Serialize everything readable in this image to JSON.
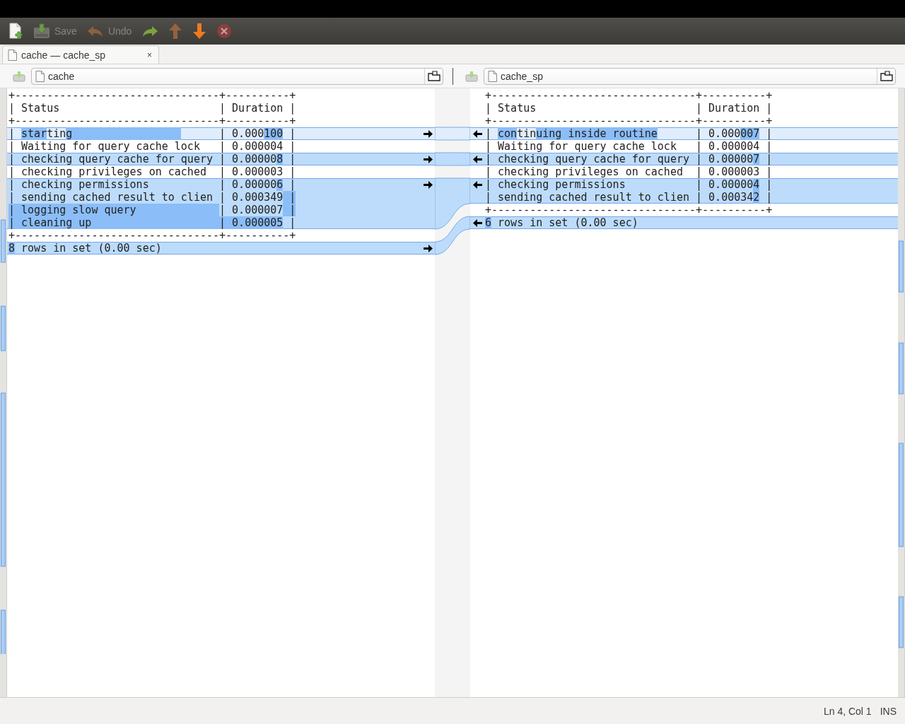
{
  "toolbar": [
    {
      "kind": "new",
      "disabled": false
    },
    {
      "kind": "save",
      "label": "Save",
      "disabled": true
    },
    {
      "kind": "undo",
      "label": "Undo",
      "disabled": true
    },
    {
      "kind": "redo",
      "disabled": false
    },
    {
      "kind": "up",
      "disabled": true
    },
    {
      "kind": "down",
      "disabled": false
    },
    {
      "kind": "stop",
      "disabled": true
    }
  ],
  "tabs": [
    {
      "label": "cache — cache_sp",
      "close": "×",
      "selected": true
    }
  ],
  "panes": [
    {
      "file": "cache",
      "lines": [
        {
          "kind": "plain",
          "arrow": false,
          "text": "+--------------------------------+----------+"
        },
        {
          "kind": "plain",
          "arrow": false,
          "text": "| Status                         | Duration |"
        },
        {
          "kind": "plain",
          "arrow": false,
          "text": "+--------------------------------+----------+"
        },
        {
          "kind": "current",
          "arrow": true,
          "segments": [
            {
              "text": "| ",
              "changed": false
            },
            {
              "text": "star",
              "changed": true
            },
            {
              "text": "tin",
              "changed": false
            },
            {
              "text": "g                 ",
              "changed": true
            },
            {
              "text": "      | 0.000",
              "changed": false
            },
            {
              "text": "100",
              "changed": true
            },
            {
              "text": " |",
              "changed": false
            }
          ]
        },
        {
          "kind": "plain",
          "arrow": false,
          "text": "| Waiting for query cache lock   | 0.000004 |"
        },
        {
          "kind": "changed",
          "arrow": true,
          "segments": [
            {
              "text": "| checking query cache for query | 0.00000",
              "changed": false
            },
            {
              "text": "8",
              "changed": true
            },
            {
              "text": " |",
              "changed": false
            }
          ]
        },
        {
          "kind": "plain",
          "arrow": false,
          "text": "| checking privileges on cached  | 0.000003 |"
        },
        {
          "kind": "changed",
          "arrow": true,
          "segments": [
            {
              "text": "| checking permissions           | 0.00000",
              "changed": false
            },
            {
              "text": "6",
              "changed": true
            },
            {
              "text": " |",
              "changed": false
            }
          ]
        },
        {
          "kind": "changed",
          "arrow": false,
          "segments": [
            {
              "text": "| sending cached result to clien | 0.000349",
              "changed": false
            },
            {
              "text": " |",
              "changed": true
            }
          ]
        },
        {
          "kind": "changed",
          "arrow": false,
          "segments": [
            {
              "text": "| logging slow query             ",
              "changed": true
            },
            {
              "text": "| 0.000007",
              "changed": false
            },
            {
              "text": " |",
              "changed": true
            }
          ]
        },
        {
          "kind": "changed",
          "arrow": false,
          "segments": [
            {
              "text": "| cleaning up                    | 0.000005",
              "changed": true
            },
            {
              "text": " |",
              "changed": false
            }
          ]
        },
        {
          "kind": "plain",
          "arrow": false,
          "text": "+--------------------------------+----------+"
        },
        {
          "kind": "changed",
          "arrow": true,
          "segments": [
            {
              "text": "8",
              "changed": true
            },
            {
              "text": " rows in set (0.00 sec)",
              "changed": false
            }
          ]
        }
      ]
    },
    {
      "file": "cache_sp",
      "lines": [
        {
          "kind": "plain",
          "arrow": false,
          "text": "+--------------------------------+----------+"
        },
        {
          "kind": "plain",
          "arrow": false,
          "text": "| Status                         | Duration |"
        },
        {
          "kind": "plain",
          "arrow": false,
          "text": "+--------------------------------+----------+"
        },
        {
          "kind": "current",
          "arrow": true,
          "segments": [
            {
              "text": "| ",
              "changed": false
            },
            {
              "text": "con",
              "changed": true
            },
            {
              "text": "tin",
              "changed": false
            },
            {
              "text": "uing inside routine",
              "changed": true
            },
            {
              "text": "      | 0.000",
              "changed": false
            },
            {
              "text": "007",
              "changed": true
            },
            {
              "text": " |",
              "changed": false
            }
          ]
        },
        {
          "kind": "plain",
          "arrow": false,
          "text": "| Waiting for query cache lock   | 0.000004 |"
        },
        {
          "kind": "changed",
          "arrow": true,
          "segments": [
            {
              "text": "| checking query cache for query | 0.00000",
              "changed": false
            },
            {
              "text": "7",
              "changed": true
            },
            {
              "text": " |",
              "changed": false
            }
          ]
        },
        {
          "kind": "plain",
          "arrow": false,
          "text": "| checking privileges on cached  | 0.000003 |"
        },
        {
          "kind": "changed",
          "arrow": true,
          "segments": [
            {
              "text": "| checking permissions           | 0.00000",
              "changed": false
            },
            {
              "text": "4",
              "changed": true
            },
            {
              "text": " |",
              "changed": false
            }
          ]
        },
        {
          "kind": "changed",
          "arrow": false,
          "segments": [
            {
              "text": "| sending cached result to clien | 0.00034",
              "changed": false
            },
            {
              "text": "2",
              "changed": true
            },
            {
              "text": " |",
              "changed": false
            }
          ]
        },
        {
          "kind": "plain",
          "arrow": false,
          "text": "+--------------------------------+----------+"
        },
        {
          "kind": "changed",
          "arrow": true,
          "segments": [
            {
              "text": "6",
              "changed": true
            },
            {
              "text": " rows in set (0.00 sec)",
              "changed": false
            }
          ]
        }
      ]
    }
  ],
  "status_bar": {
    "position": "Ln 4, Col 1",
    "mode": "INS"
  }
}
